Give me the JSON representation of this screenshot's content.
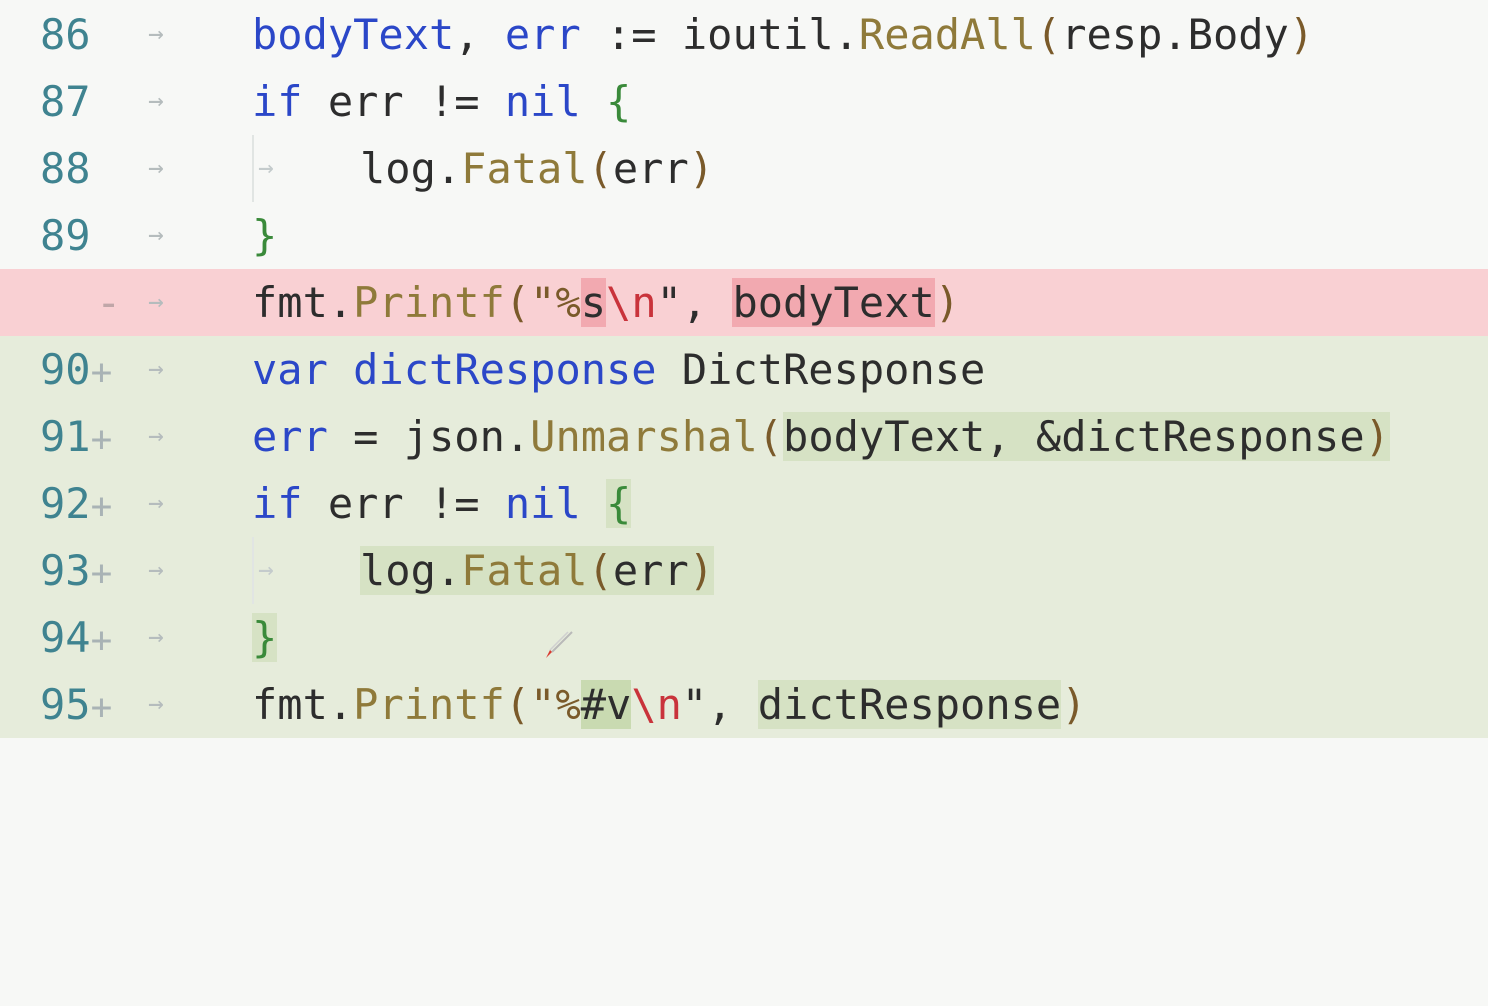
{
  "diff": {
    "lines": [
      {
        "num": "86",
        "tokens": [
          "bodyText",
          ", ",
          "err",
          " := ",
          "ioutil",
          ".",
          "ReadAll",
          "(",
          "resp",
          ".",
          "Body",
          ")"
        ]
      },
      {
        "num": "87",
        "tokens": [
          "if",
          " err != ",
          "nil",
          " ",
          "{"
        ]
      },
      {
        "num": "88",
        "tokens": [
          "log",
          ".",
          "Fatal",
          "(",
          "err",
          ")"
        ]
      },
      {
        "num": "89",
        "tokens": [
          "}"
        ]
      },
      {
        "num": "-",
        "tokens": [
          "fmt",
          ".",
          "Printf",
          "(\"%",
          "s",
          "\\n",
          "\", ",
          "bodyText",
          ")"
        ]
      },
      {
        "num": "90",
        "tokens": [
          "var",
          " ",
          "dictResponse",
          " DictResponse"
        ]
      },
      {
        "num": "91",
        "tokens": [
          "err",
          " = ",
          "json",
          ".",
          "Unmarshal",
          "(",
          "bodyText, &dictResponse",
          ")"
        ]
      },
      {
        "num": "92",
        "tokens": [
          "if",
          " err != ",
          "nil",
          " ",
          "{"
        ]
      },
      {
        "num": "93",
        "tokens": [
          "log",
          ".",
          "Fatal",
          "(",
          "err",
          ")"
        ]
      },
      {
        "num": "94",
        "tokens": [
          "}"
        ]
      },
      {
        "num": "95",
        "tokens": [
          "fmt",
          ".",
          "Printf",
          "(\"%",
          "#v",
          "\\n",
          "\", ",
          "dictResponse",
          ")"
        ]
      }
    ],
    "plus_marker": "+",
    "arrow_glyph": "→",
    "colors": {
      "removed_bg": "#f9d0d3",
      "added_bg": "#e6ecdb",
      "keyword": "#2b47c8",
      "function": "#8f7a3a",
      "line_number": "#3f8390"
    }
  }
}
